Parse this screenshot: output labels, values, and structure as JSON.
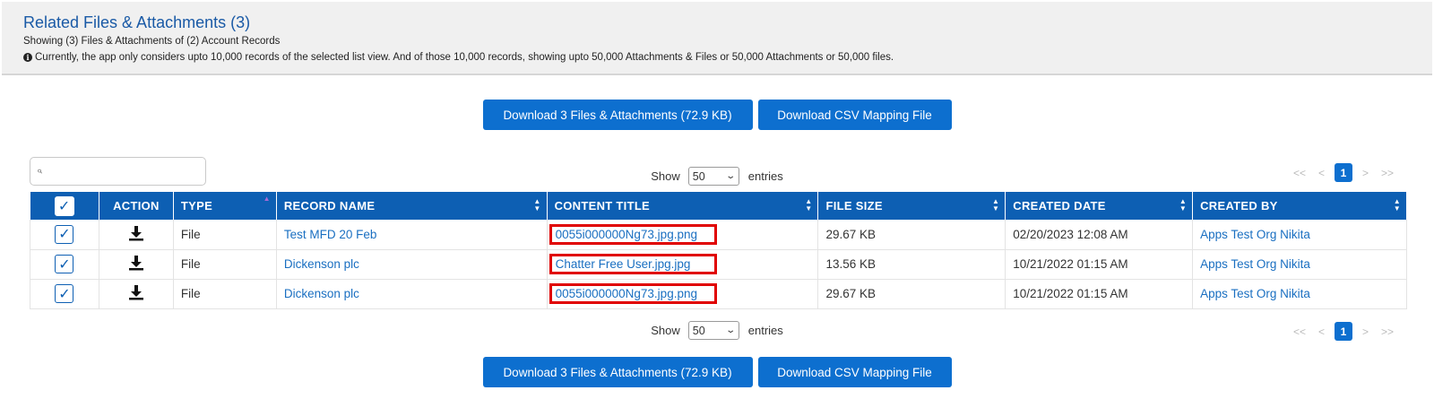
{
  "header": {
    "title": "Related Files & Attachments (3)",
    "subtitle": "Showing (3) Files & Attachments of (2) Account Records",
    "note": "Currently, the app only considers upto 10,000 records of the selected list view. And of those 10,000 records, showing upto 50,000 Attachments & Files or 50,000 Attachments or 50,000 files."
  },
  "buttons": {
    "download_label": "Download 3 Files & Attachments (72.9 KB)",
    "csv_label": "Download CSV Mapping File"
  },
  "search": {
    "placeholder": ""
  },
  "entries": {
    "show_label": "Show",
    "value": "50",
    "suffix": "entries"
  },
  "pager": {
    "first": "<<",
    "prev": "<",
    "current": "1",
    "next": ">",
    "last": ">>"
  },
  "table": {
    "columns": [
      "ACTION",
      "TYPE",
      "RECORD NAME",
      "CONTENT TITLE",
      "FILE SIZE",
      "CREATED DATE",
      "CREATED BY"
    ],
    "rows": [
      {
        "type": "File",
        "record_name": "Test MFD 20 Feb",
        "content_title": "0055i000000Ng73.jpg.png",
        "file_size": "29.67 KB",
        "created_date": "02/20/2023 12:08 AM",
        "created_by": "Apps Test Org Nikita"
      },
      {
        "type": "File",
        "record_name": "Dickenson plc",
        "content_title": "Chatter Free User.jpg.jpg",
        "file_size": "13.56 KB",
        "created_date": "10/21/2022 01:15 AM",
        "created_by": "Apps Test Org Nikita"
      },
      {
        "type": "File",
        "record_name": "Dickenson plc",
        "content_title": "0055i000000Ng73.jpg.png",
        "file_size": "29.67 KB",
        "created_date": "10/21/2022 01:15 AM",
        "created_by": "Apps Test Org Nikita"
      }
    ]
  },
  "colors": {
    "primary": "#0d6fcf",
    "header_blue": "#0d5fb3",
    "link": "#1a6fc1",
    "highlight": "#e00000"
  },
  "icons": {
    "info": "info-icon",
    "search": "search-icon",
    "download": "download-icon",
    "check": "check-icon"
  }
}
